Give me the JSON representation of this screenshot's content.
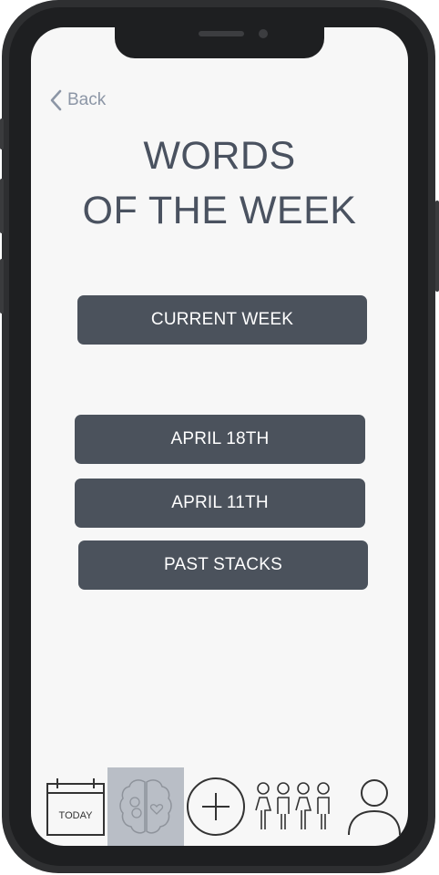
{
  "header": {
    "back_label": "Back",
    "title_line1": "WORDS",
    "title_line2": "OF THE WEEK"
  },
  "buttons": {
    "current_week": "CURRENT WEEK",
    "april_18": "APRIL 18TH",
    "april_11": "APRIL 11TH",
    "past_stacks": "PAST STACKS"
  },
  "bottom_nav": {
    "today_label": "TODAY",
    "icons": [
      "calendar-icon",
      "brain-icon",
      "add-icon",
      "group-icon",
      "profile-icon"
    ],
    "active_item": "brain-icon"
  },
  "colors": {
    "button_bg": "#4b525c",
    "title_text": "#4a5260",
    "back_text": "#8c96a6",
    "active_nav_bg": "#b9bec6"
  }
}
